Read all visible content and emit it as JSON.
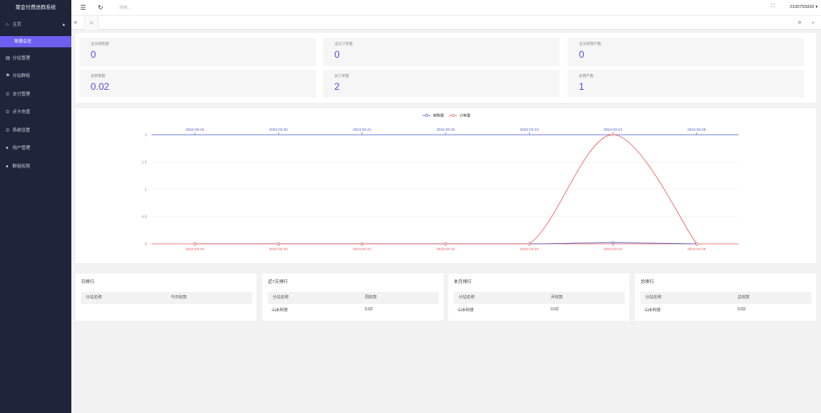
{
  "app": {
    "title": "聚金付费进群系统"
  },
  "sidebar": {
    "home": {
      "label": "主页",
      "icon": "home-icon"
    },
    "sub": {
      "label": "数据总览"
    },
    "items": [
      {
        "label": "分站管理",
        "icon": "grid-icon"
      },
      {
        "label": "分站群组",
        "icon": "tag-icon"
      },
      {
        "label": "支付管理",
        "icon": "circle-check-icon"
      },
      {
        "label": "点卡充值",
        "icon": "circle-check-icon"
      },
      {
        "label": "系统设置",
        "icon": "circle-check-icon"
      },
      {
        "label": "用户管理",
        "icon": "user-icon"
      },
      {
        "label": "群组权限",
        "icon": "user-icon"
      }
    ]
  },
  "topbar": {
    "search_placeholder": "搜索...",
    "username": "2100755992"
  },
  "stats": [
    {
      "label": "当天销售额",
      "value": "0"
    },
    {
      "label": "当天订单量",
      "value": "0"
    },
    {
      "label": "当天新用户数",
      "value": "0"
    },
    {
      "label": "总销售额",
      "value": "0.02"
    },
    {
      "label": "总订单量",
      "value": "2"
    },
    {
      "label": "总用户数",
      "value": "1"
    }
  ],
  "chart_data": {
    "type": "line",
    "x": [
      "2024-03-19",
      "2024-03-20",
      "2024-03-21",
      "2024-03-22",
      "2024-03-23",
      "2024-03-24",
      "2024-03-25"
    ],
    "series": [
      {
        "name": "销售额",
        "color": "#4f5fc8",
        "values": [
          0,
          0,
          0,
          0,
          0,
          0.02,
          0
        ]
      },
      {
        "name": "订单量",
        "color": "#e8625f",
        "values": [
          0,
          0,
          0,
          0,
          0,
          2,
          0
        ]
      }
    ],
    "yticks": [
      "0",
      "0.5",
      "1",
      "1.5",
      "2"
    ],
    "ylim": [
      0,
      2
    ],
    "legend": "top-center",
    "smooth": true
  },
  "rankings": [
    {
      "title": "日排行",
      "col1": "分站名称",
      "col2": "今日收款",
      "rows": []
    },
    {
      "title": "近7天排行",
      "col1": "分站名称",
      "col2": "周收款",
      "rows": [
        {
          "name": "山水科技",
          "amount": "0.02"
        }
      ]
    },
    {
      "title": "本月排行",
      "col1": "分站名称",
      "col2": "月收款",
      "rows": [
        {
          "name": "山水科技",
          "amount": "0.02"
        }
      ]
    },
    {
      "title": "总排行",
      "col1": "分站名称",
      "col2": "总收款",
      "rows": [
        {
          "name": "山水科技",
          "amount": "0.02"
        }
      ]
    }
  ]
}
